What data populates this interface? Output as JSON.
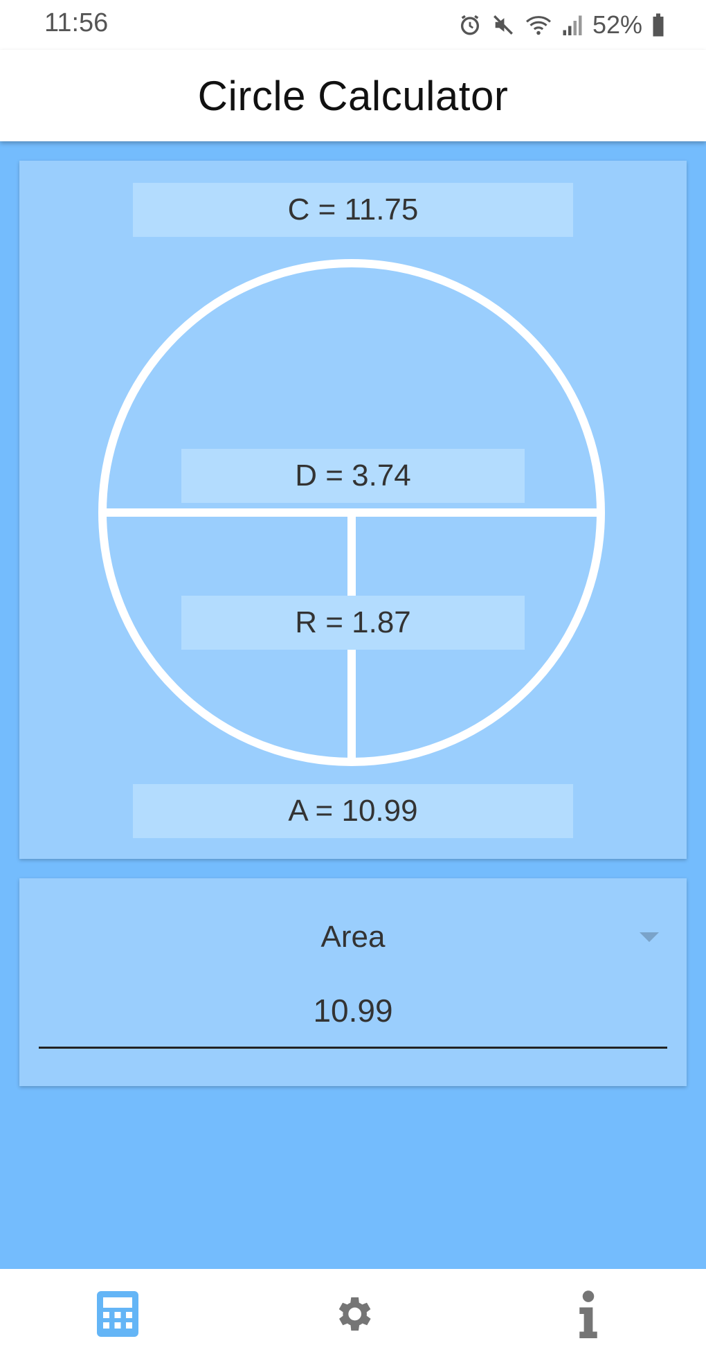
{
  "status_bar": {
    "time": "11:56",
    "battery": "52%",
    "icons": [
      "alarm-icon",
      "mute-icon",
      "wifi-icon",
      "signal-icon",
      "battery-icon"
    ]
  },
  "app_bar": {
    "title": "Circle Calculator"
  },
  "diagram": {
    "circumference_label": "C = 11.75",
    "diameter_label": "D = 3.74",
    "radius_label": "R = 1.87",
    "area_label": "A = 10.99"
  },
  "input_card": {
    "selected_measure": "Area",
    "input_value": "10.99"
  },
  "bottom_nav": {
    "items": [
      {
        "name": "calculator-icon",
        "active": true
      },
      {
        "name": "settings-icon",
        "active": false
      },
      {
        "name": "info-icon",
        "active": false
      }
    ]
  },
  "colors": {
    "background": "#74bcfd",
    "card": "#9acefd",
    "label_box": "#b3dcfe",
    "active_nav": "#64b5f6",
    "inactive_nav": "#757575"
  }
}
